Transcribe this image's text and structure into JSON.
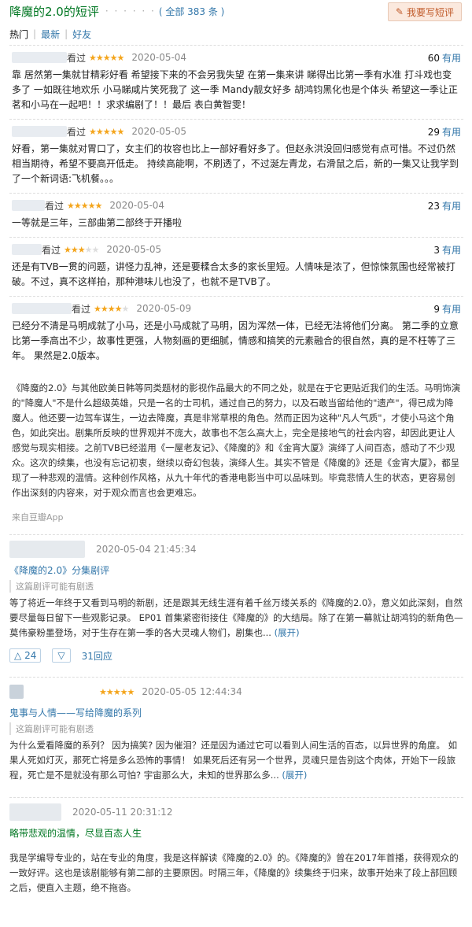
{
  "header": {
    "title": "降魔的2.0的短评",
    "dots": "· · · · · ·",
    "total": "( 全部 383 条 )",
    "write_btn": "我要写短评"
  },
  "tabs": [
    "热门",
    "最新",
    "好友"
  ],
  "short_comments": [
    {
      "user": "看过",
      "stars": 5,
      "date": "2020-05-04",
      "votes": "60",
      "useful": "有用",
      "content": "靠 居然第一集就甘精彩好看 希望接下来的不会另我失望 在第一集来讲 睇得出比第一季有水准 打斗戏也变多了 一如既往地欢乐 小马睇咸片笑死我了 这一季 Mandy靓女好多 胡鸿钧黑化也是个体头 希望这一季让正茗和小马在一起吧！！求求编剧了！！最后 表白黄智雯！"
    },
    {
      "user": "看过",
      "stars": 5,
      "date": "2020-05-05",
      "votes": "29",
      "useful": "有用",
      "content": "好看，第一集就对胃口了，女主们的妆容也比上一部好看好多了。但赵永洪没回归感觉有点可惜。不过仍然相当期待，希望不要高开低走。 持续高能啊，不刷透了，不过涎左青龙，右滑鼠之后，新的一集又让我学到了一个新词语:飞机餐。。。"
    },
    {
      "user": "看过",
      "stars": 5,
      "date": "2020-05-04",
      "votes": "23",
      "useful": "有用",
      "content": "一等就是三年，三部曲第二部终于开播啦"
    },
    {
      "user": "看过",
      "stars": 3,
      "date": "2020-05-05",
      "votes": "3",
      "useful": "有用",
      "content": "还是有TVB一贯的问题，讲怪力乱神，还是要糅合太多的家长里短。人情味是浓了，但惊悚氛围也经常被打破。不过，真不这样拍，那种港味儿也没了，也就不是TVB了。"
    },
    {
      "user": "看过",
      "stars": 4,
      "date": "2020-05-09",
      "votes": "9",
      "useful": "有用",
      "content": "已经分不清是马明成就了小马，还是小马成就了马明，因为浑然一体，已经无法将他们分离。 第二季的立意比第一季高出不少，故事性更强，人物刻画的更细腻，情感和搞笑的元素融合的很自然，真的是不枉等了三年。 果然是2.0版本。"
    }
  ],
  "long_excerpt": {
    "text": "《降魔的2.0》与其他欧美日韩等同类题材的影视作品最大的不同之处，就是在于它更贴近我们的生活。马明饰演的\"降魔人\"不是什么超级英雄，只是一名的士司机，通过自己的努力，以及石敢当留给他的\"遗产\"，得已成为降魔人。他还要一边驾车谋生，一边去降魔，真是非常草根的角色。然而正因为这种\"凡人气质\"，才使小马这个角色，如此突出。剧集所反映的世界观并不庞大，故事也不怎么高大上，完全是接地气的社会内容，却因此更让人感觉与现实相接。之前TVB已经滥用《一屋老友记》、《降魔的》和《金宵大厦》演绎了人间百态，感动了不少观众。这次的续集，也没有忘记初衷，继续以奇幻包装，演绎人生。其实不管是《降魔的》还是《金宵大厦》，都呈现了一种悲观的温情。这种创作风格，从九十年代的香港电影当中可以品味到。毕竟悲情人生的状态，更容易创作出深刻的内容来，对于观众而言也会更难忘。",
    "source": "来自豆瓣App"
  },
  "reviews": [
    {
      "datetime": "2020-05-04 21:45:34",
      "stars": 0,
      "title": "《降魔的2.0》分集剧评",
      "title_green": false,
      "spoiler": "这篇剧评可能有剧透",
      "body": "等了将近一年终于又看到马明的新剧，还是跟其无线生涯有着千丝万缕关系的《降魔的2.0》，意义如此深刻，自然要尽量每日留下一些观影记录。 EP01 首集紧密衔接住《降魔的》的大结局。除了在第一幕就让胡鸿钧的新角色—莫伟豪粉墨登场，对于生存在第一季的各大灵魂人物们，剧集也...",
      "expand": "(展开)",
      "up": "24",
      "replies": "31回应"
    },
    {
      "datetime": "2020-05-05 12:44:34",
      "stars": 5,
      "title": "鬼事与人情——写给降魔的系列",
      "title_green": false,
      "spoiler": "这篇剧评可能有剧透",
      "body": "为什么爱看降魔的系列？ 因为搞笑? 因为催泪？还是因为通过它可以看到人间生活的百态，以异世界的角度。 如果人死如灯灭，那死亡将是多么恐怖的事情！ 如果死后还有另一个世界，灵魂只是告别这个肉体，开始下一段旅程，死亡是不是就没有那么可怕? 宇宙那么大，未知的世界那么多...",
      "expand": "(展开)"
    },
    {
      "datetime": "2020-05-11 20:31:12",
      "stars": 0,
      "title": "略带悲观的温情，尽显百态人生",
      "title_green": true,
      "body": "我是学编导专业的，站在专业的角度，我是这样解读《降魔的2.0》的。《降魔的》曾在2017年首播，获得观众的一致好评。这也是该剧能够有第二部的主要原因。时隔三年，《降魔的》续集终于归来，故事开始来了段上部回顾之后，便直入主题，绝不拖沓。"
    }
  ],
  "icons": {
    "pencil": "pencil-icon",
    "up": "thumb-up-icon",
    "down": "thumb-down-icon"
  }
}
